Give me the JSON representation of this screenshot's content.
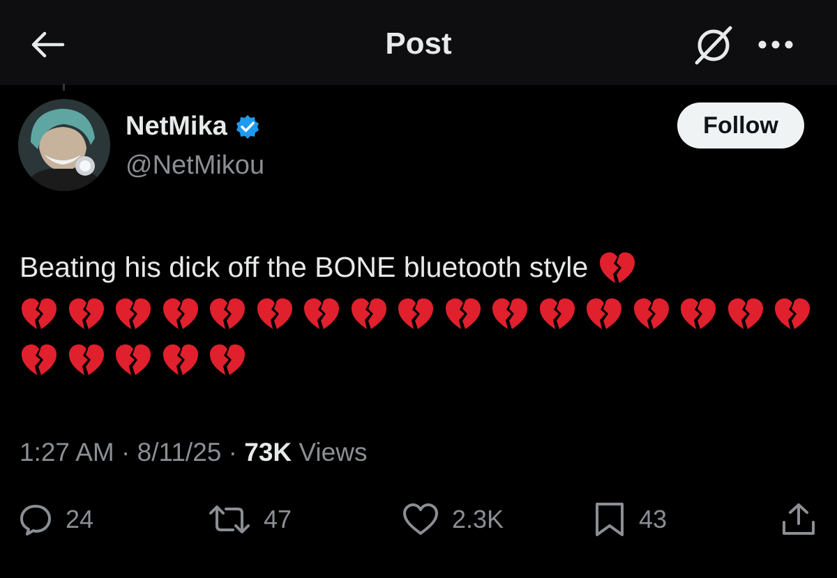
{
  "header": {
    "title": "Post",
    "back_icon": "arrow-left-icon",
    "grok_icon": "grok-icon",
    "more_icon": "more-horizontal-icon"
  },
  "author": {
    "display_name": "NetMika",
    "handle": "@NetMikou",
    "verified": true,
    "verified_color": "#1d9bf0"
  },
  "follow_label": "Follow",
  "post": {
    "text": "Beating his dick off the BONE bluetooth style",
    "emoji": "💔",
    "emoji_name": "broken-heart",
    "emoji_count": 23
  },
  "meta": {
    "time": "1:27 AM",
    "date": "8/11/25",
    "views_count": "73K",
    "views_label": "Views"
  },
  "actions": {
    "replies": "24",
    "reposts": "47",
    "likes": "2.3K",
    "bookmarks": "43"
  },
  "colors": {
    "background": "#000000",
    "header_bg": "#0e0e10",
    "text_primary": "#e7e9ea",
    "text_secondary": "#8b8f94",
    "follow_button_bg": "#eff3f4",
    "broken_heart": "#e0202d"
  }
}
